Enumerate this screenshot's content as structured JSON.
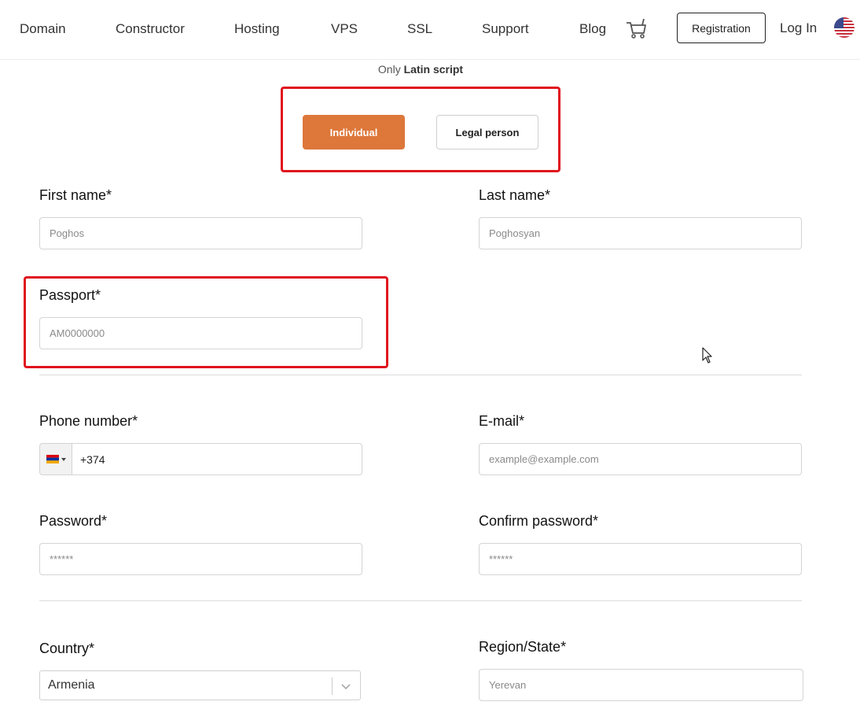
{
  "nav": {
    "items": [
      "Domain",
      "Constructor",
      "Hosting",
      "VPS",
      "SSL",
      "Support",
      "Blog"
    ],
    "cart_icon": "cart-icon",
    "registration_label": "Registration",
    "login_label": "Log In",
    "language_flag": "us-flag-icon"
  },
  "note": {
    "prefix": "Only",
    "bold": "Latin script"
  },
  "person_type": {
    "options": [
      "Individual",
      "Legal person"
    ],
    "selected": "Individual",
    "active_color": "#dd773a"
  },
  "form": {
    "first_name": {
      "label": "First name*",
      "placeholder": "Poghos"
    },
    "last_name": {
      "label": "Last name*",
      "placeholder": "Poghosyan"
    },
    "passport": {
      "label": "Passport*",
      "placeholder": "AM0000000"
    },
    "phone": {
      "label": "Phone number*",
      "value": "+374",
      "country_flag": "armenia-flag-icon"
    },
    "email": {
      "label": "E-mail*",
      "placeholder": "example@example.com"
    },
    "password": {
      "label": "Password*",
      "placeholder": "******"
    },
    "confirm_password": {
      "label": "Confirm password*",
      "placeholder": "******"
    },
    "country": {
      "label": "Country*",
      "value": "Armenia"
    },
    "region": {
      "label": "Region/State*",
      "placeholder": "Yerevan"
    }
  },
  "highlight_color": "#e0141e"
}
